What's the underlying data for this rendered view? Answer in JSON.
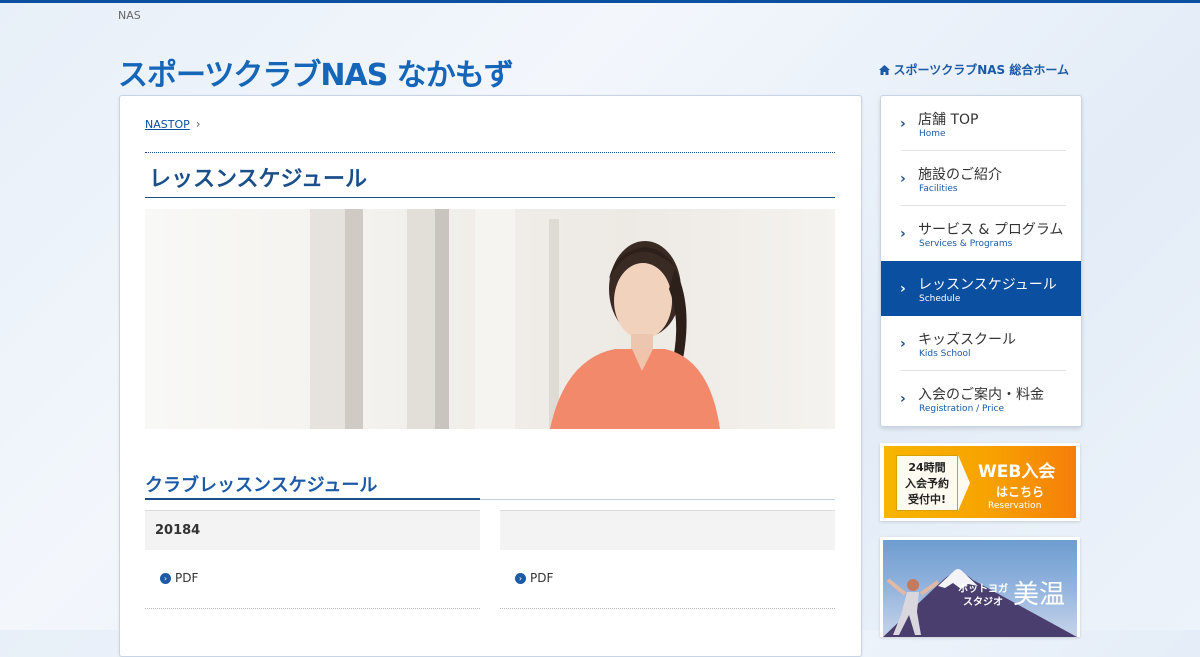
{
  "top_label": "NAS",
  "header": {
    "title": "スポーツクラブNAS なかもず",
    "home_link": "スポーツクラブNAS 総合ホーム"
  },
  "breadcrumb": {
    "home": "NASTOP"
  },
  "page": {
    "title": "レッスンスケジュール",
    "section_title": "クラブレッスンスケジュール"
  },
  "schedule": {
    "columns": [
      {
        "header": "20184",
        "link": "PDF"
      },
      {
        "header": "",
        "link": "PDF"
      }
    ]
  },
  "sidebar": {
    "items": [
      {
        "label": "店舗 TOP",
        "sub": "Home"
      },
      {
        "label": "施設のご紹介",
        "sub": "Facilities"
      },
      {
        "label": "サービス & プログラム",
        "sub": "Services & Programs"
      },
      {
        "label": "レッスンスケジュール",
        "sub": "Schedule",
        "active": true
      },
      {
        "label": "キッズスクール",
        "sub": "Kids School"
      },
      {
        "label": "入会のご案内・料金",
        "sub": "Registration / Price"
      }
    ]
  },
  "banners": {
    "web": {
      "box_line1": "24時間",
      "box_line2": "入会予約",
      "box_line3": "受付中!",
      "big": "WEB入会",
      "mid": "はこちら",
      "small": "Reservation"
    },
    "yoga": {
      "line1": "ホットヨガ",
      "line2": "スタジオ",
      "name": "美温"
    }
  },
  "colors": {
    "brand": "#0b4fa0",
    "accent_orange": "#f7a200"
  }
}
